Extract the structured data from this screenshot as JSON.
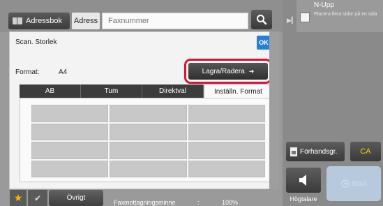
{
  "header": {
    "addressbook_label": "Adressbok",
    "address_tab_label": "Adress",
    "fax_placeholder": "Faxnummer"
  },
  "right_panel": {
    "nupp_title": "N-Upp",
    "nupp_subtitle": "Placera flera sidor på en sida",
    "preview_label": "Förhandsgr.",
    "ca_label": "CA",
    "speaker_label": "Högtalare",
    "start_label": "Start"
  },
  "dialog": {
    "title": "Scan. Storlek",
    "ok_label": "OK",
    "format_label": "Format:",
    "format_value": "A4",
    "save_delete_label": "Lagra/Radera",
    "tabs": [
      {
        "label": "AB",
        "active": false
      },
      {
        "label": "Tum",
        "active": false
      },
      {
        "label": "Direktval",
        "active": false
      },
      {
        "label": "Inställn. Format",
        "active": true
      }
    ],
    "grid_rows": 4,
    "grid_cols": 3
  },
  "bottom_bar": {
    "other_label": "Övrigt",
    "memory_label": "Faxmottagningsminne",
    "memory_separator": ":",
    "memory_value": "100%"
  },
  "colors": {
    "highlight": "#d4143a",
    "ok_blue": "#2a7fd0",
    "ca_yellow": "#ffd200",
    "star_orange": "#ffb400"
  }
}
